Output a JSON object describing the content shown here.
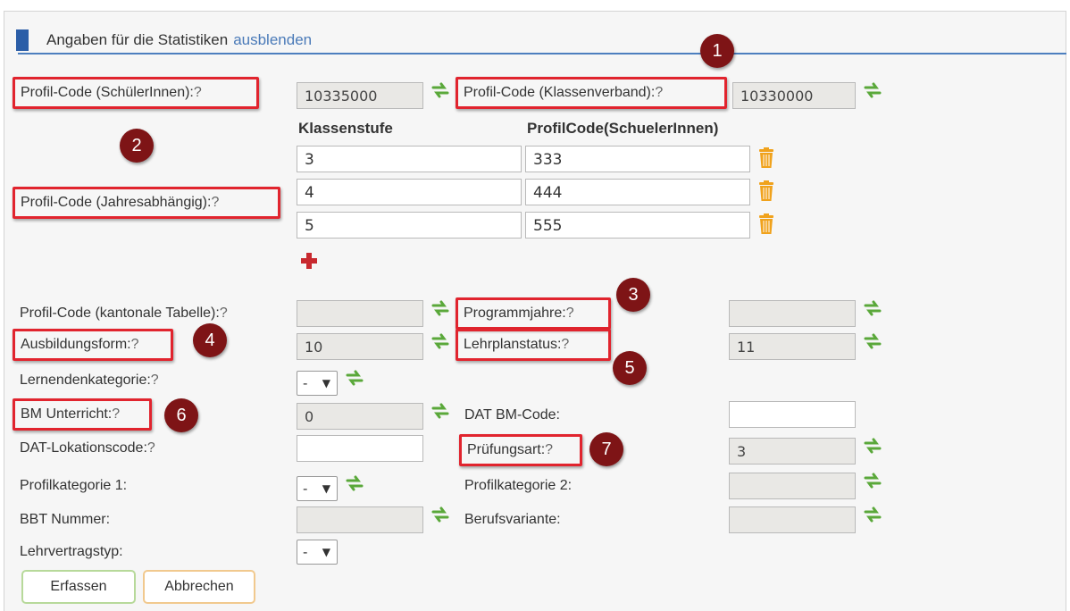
{
  "header": {
    "title": "Angaben für die Statistiken",
    "toggle_link": "ausblenden"
  },
  "help_mark": "?",
  "labels": {
    "profil_schueler": "Profil-Code (SchülerInnen):",
    "profil_klassenverband": "Profil-Code (Klassenverband):",
    "profil_jahres": "Profil-Code (Jahresabhängig):",
    "profil_kantonal": "Profil-Code (kantonale Tabelle):",
    "programmjahre": "Programmjahre:",
    "ausbildungsform": "Ausbildungsform:",
    "lehrplanstatus": "Lehrplanstatus:",
    "lernendenkategorie": "Lernendenkategorie:",
    "bm_unterricht": "BM Unterricht:",
    "dat_bm_code": "DAT BM-Code:",
    "dat_lokationscode": "DAT-Lokationscode:",
    "pruefungsart": "Prüfungsart:",
    "profilkategorie_1": "Profilkategorie 1:",
    "profilkategorie_2": "Profilkategorie 2:",
    "bbt_nummer": "BBT Nummer:",
    "berufsvariante": "Berufsvariante:",
    "lehrvertragstyp": "Lehrvertragstyp:"
  },
  "values": {
    "profil_schueler": "10335000",
    "profil_klassenverband": "10330000",
    "profil_kantonal": "",
    "programmjahre": "",
    "ausbildungsform": "10",
    "lehrplanstatus": "11",
    "bm_unterricht": "0",
    "dat_bm_code": "",
    "dat_lokationscode": "",
    "pruefungsart": "3",
    "profilkategorie_2": "",
    "bbt_nummer": "",
    "berufsvariante": ""
  },
  "selects": {
    "lernendenkategorie": "-",
    "profilkategorie_1": "-",
    "lehrvertragstyp": "-"
  },
  "jahres_table": {
    "col_klassenstufe": "Klassenstufe",
    "col_profilcode": "ProfilCode(SchuelerInnen)",
    "rows": [
      {
        "klassenstufe": "3",
        "profilcode": "333"
      },
      {
        "klassenstufe": "4",
        "profilcode": "444"
      },
      {
        "klassenstufe": "5",
        "profilcode": "555"
      }
    ]
  },
  "badges": [
    "1",
    "2",
    "3",
    "4",
    "5",
    "6",
    "7"
  ],
  "buttons": {
    "erfassen": "Erfassen",
    "abbrechen": "Abbrechen"
  },
  "icons": {
    "sync": "sync-arrows-icon",
    "trash": "trash-icon",
    "add": "plus-icon"
  },
  "colors": {
    "accent_blue": "#2b5ea7",
    "highlight_red": "#e1242e",
    "badge_red": "#7e1416",
    "sync_green": "#5aa83a",
    "trash_orange": "#f0a21c",
    "add_red": "#c8292f"
  }
}
